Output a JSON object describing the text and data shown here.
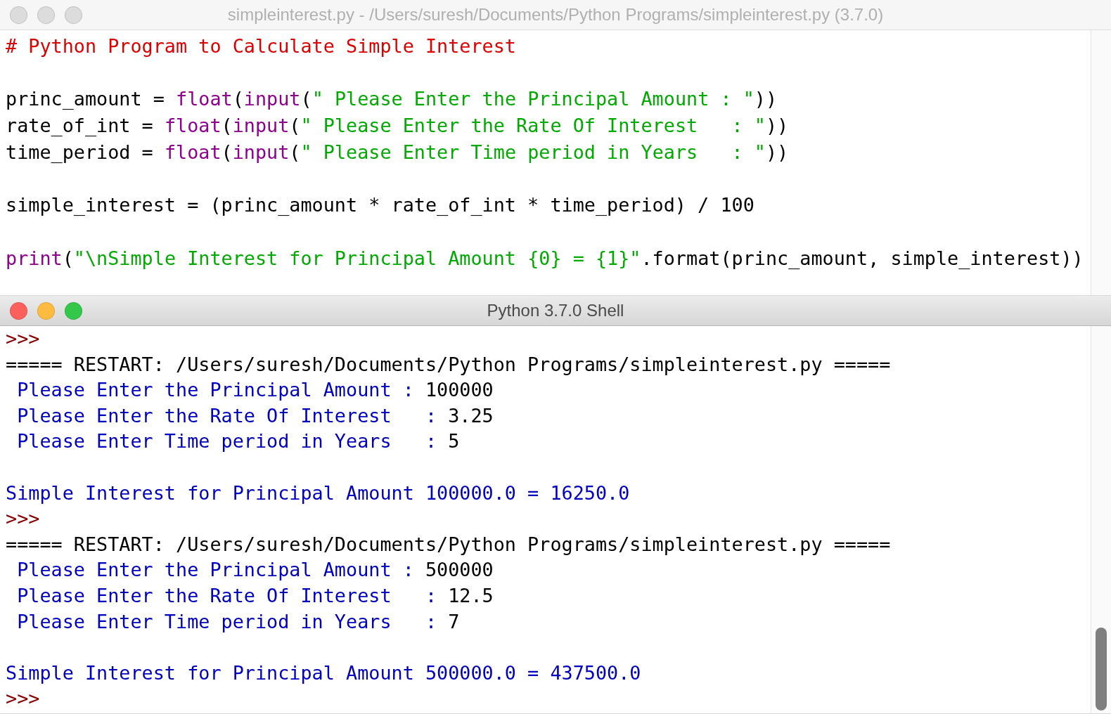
{
  "editor": {
    "title": "simpleinterest.py - /Users/suresh/Documents/Python Programs/simpleinterest.py (3.7.0)",
    "active": false,
    "lines": [
      {
        "kind": "code",
        "segments": [
          {
            "kind": "comment",
            "text": "# Python Program to Calculate Simple Interest"
          }
        ]
      },
      {
        "kind": "blank"
      },
      {
        "kind": "code",
        "segments": [
          {
            "kind": "plain",
            "text": "princ_amount = "
          },
          {
            "kind": "builtin",
            "text": "float"
          },
          {
            "kind": "plain",
            "text": "("
          },
          {
            "kind": "builtin",
            "text": "input"
          },
          {
            "kind": "plain",
            "text": "("
          },
          {
            "kind": "string",
            "text": "\" Please Enter the Principal Amount : \""
          },
          {
            "kind": "plain",
            "text": "))"
          }
        ]
      },
      {
        "kind": "code",
        "segments": [
          {
            "kind": "plain",
            "text": "rate_of_int = "
          },
          {
            "kind": "builtin",
            "text": "float"
          },
          {
            "kind": "plain",
            "text": "("
          },
          {
            "kind": "builtin",
            "text": "input"
          },
          {
            "kind": "plain",
            "text": "("
          },
          {
            "kind": "string",
            "text": "\" Please Enter the Rate Of Interest   : \""
          },
          {
            "kind": "plain",
            "text": "))"
          }
        ]
      },
      {
        "kind": "code",
        "segments": [
          {
            "kind": "plain",
            "text": "time_period = "
          },
          {
            "kind": "builtin",
            "text": "float"
          },
          {
            "kind": "plain",
            "text": "("
          },
          {
            "kind": "builtin",
            "text": "input"
          },
          {
            "kind": "plain",
            "text": "("
          },
          {
            "kind": "string",
            "text": "\" Please Enter Time period in Years   : \""
          },
          {
            "kind": "plain",
            "text": "))"
          }
        ]
      },
      {
        "kind": "blank"
      },
      {
        "kind": "code",
        "segments": [
          {
            "kind": "plain",
            "text": "simple_interest = (princ_amount * rate_of_int * time_period) / 100"
          }
        ]
      },
      {
        "kind": "blank"
      },
      {
        "kind": "code",
        "segments": [
          {
            "kind": "builtin",
            "text": "print"
          },
          {
            "kind": "plain",
            "text": "("
          },
          {
            "kind": "string",
            "text": "\"\\nSimple Interest for Principal Amount {0} = {1}\""
          },
          {
            "kind": "plain",
            "text": ".format(princ_amount, simple_interest))"
          }
        ]
      }
    ]
  },
  "shell": {
    "title": "Python 3.7.0 Shell",
    "active": true,
    "lines": [
      {
        "kind": "prompt",
        "text": ">>>"
      },
      {
        "kind": "restart",
        "text": "===== RESTART: /Users/suresh/Documents/Python Programs/simpleinterest.py ====="
      },
      {
        "kind": "input",
        "text": " Please Enter the Principal Amount : ",
        "value": "100000"
      },
      {
        "kind": "input",
        "text": " Please Enter the Rate Of Interest   : ",
        "value": "3.25"
      },
      {
        "kind": "input",
        "text": " Please Enter Time period in Years   : ",
        "value": "5"
      },
      {
        "kind": "blank"
      },
      {
        "kind": "output",
        "text": "Simple Interest for Principal Amount 100000.0 = 16250.0"
      },
      {
        "kind": "prompt",
        "text": ">>>"
      },
      {
        "kind": "restart",
        "text": "===== RESTART: /Users/suresh/Documents/Python Programs/simpleinterest.py ====="
      },
      {
        "kind": "input",
        "text": " Please Enter the Principal Amount : ",
        "value": "500000"
      },
      {
        "kind": "input",
        "text": " Please Enter the Rate Of Interest   : ",
        "value": "12.5"
      },
      {
        "kind": "input",
        "text": " Please Enter Time period in Years   : ",
        "value": "7"
      },
      {
        "kind": "blank"
      },
      {
        "kind": "output",
        "text": "Simple Interest for Principal Amount 500000.0 = 437500.0"
      },
      {
        "kind": "prompt",
        "text": ">>>"
      }
    ]
  }
}
